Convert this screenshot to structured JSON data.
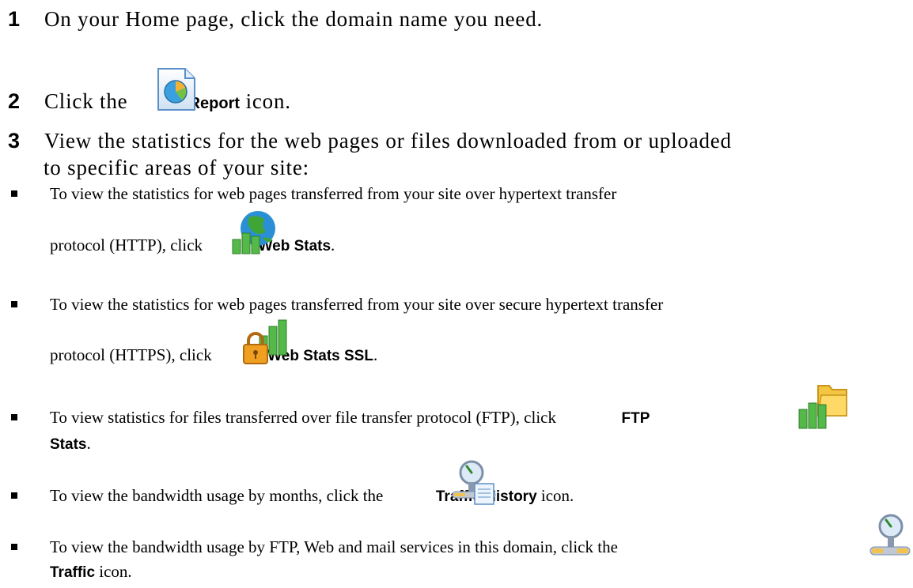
{
  "steps": [
    {
      "num": "1",
      "text": "On your Home page, click the domain name you need."
    },
    {
      "num": "2",
      "before": "Click the",
      "label": "Report",
      "after": "icon.",
      "icon": "report-icon"
    },
    {
      "num": "3",
      "line1": "View the statistics for the web pages or files downloaded from or uploaded",
      "line2": "to specific areas of your site:"
    }
  ],
  "bullets": [
    {
      "line1": "To view the statistics for web pages transferred from your site over hypertext transfer",
      "line2_before": "protocol (HTTP), click",
      "label": "Web Stats",
      "after": ".",
      "icon": "web-stats-icon"
    },
    {
      "line1": "To view the statistics for web pages transferred from your site over secure hypertext transfer",
      "line2_before": "protocol (HTTPS), click",
      "label": "Web Stats SSL",
      "after": ".",
      "icon": "web-stats-ssl-icon"
    },
    {
      "line1_before": "To view statistics for files transferred over file transfer protocol (FTP), click",
      "label_part1": "FTP",
      "label_part2": "Stats",
      "after": ".",
      "icon": "ftp-stats-icon"
    },
    {
      "before": "To view the bandwidth usage by months, click the",
      "label": "Traffic History",
      "after": "icon.",
      "icon": "traffic-history-icon"
    },
    {
      "line1": "To view the bandwidth usage by FTP, Web and mail services in this domain, click the",
      "label": "Traffic",
      "after": "icon.",
      "icon": "traffic-icon"
    }
  ]
}
